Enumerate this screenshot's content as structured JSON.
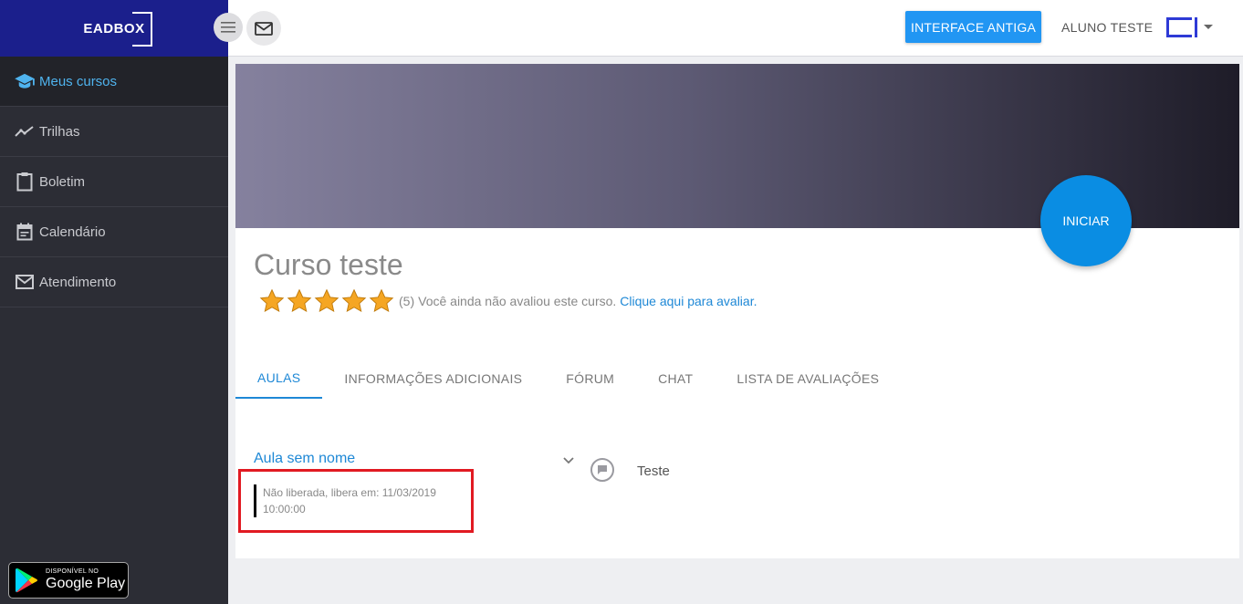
{
  "sidebar": {
    "logo": "EADBOX",
    "items": [
      {
        "label": "Meus cursos",
        "icon": "graduation-cap-icon",
        "active": true
      },
      {
        "label": "Trilhas",
        "icon": "trending-icon",
        "active": false
      },
      {
        "label": "Boletim",
        "icon": "clipboard-icon",
        "active": false
      },
      {
        "label": "Calendário",
        "icon": "calendar-icon",
        "active": false
      },
      {
        "label": "Atendimento",
        "icon": "mail-icon",
        "active": false
      }
    ],
    "store_badge": {
      "small": "DISPONÍVEL NO",
      "big": "Google Play"
    }
  },
  "topbar": {
    "menu_icon": "hamburger-icon",
    "messages_icon": "mail-icon",
    "old_interface_label": "INTERFACE ANTIGA",
    "user_name": "ALUNO TESTE"
  },
  "course": {
    "start_label": "INICIAR",
    "title": "Curso teste",
    "stars": 5,
    "rating_count": "(5)",
    "rating_text": "Você ainda não avaliou este curso.",
    "rating_link": "Clique aqui para avaliar."
  },
  "tabs": [
    "AULAS",
    "INFORMAÇÕES ADICIONAIS",
    "FÓRUM",
    "CHAT",
    "LISTA DE AVALIAÇÕES"
  ],
  "lesson": {
    "title": "Aula sem nome",
    "status_line1": "Não liberada, libera em: 11/03/2019",
    "status_line2": "10:00:00",
    "item_label": "Teste"
  },
  "colors": {
    "accent": "#1e88d6",
    "sidebar_bg": "#2c2d35",
    "logo_bar": "#1b1f8c",
    "button": "#2196f3",
    "highlight": "#e11a22",
    "star": "#f5a623"
  }
}
